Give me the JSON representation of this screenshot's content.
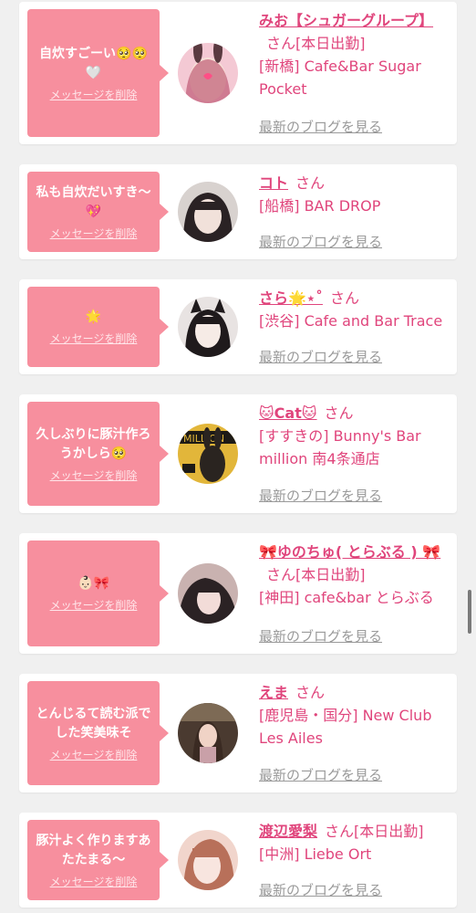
{
  "common": {
    "delete_label": "メッセージを削除",
    "blog_label": "最新のブログを見る",
    "san": "さん"
  },
  "colors": {
    "accent": "#e0457c",
    "bubble": "#f78f9e",
    "background": "#f0f0f0",
    "link_gray": "#9a9a9a"
  },
  "items": [
    {
      "message": "自炊すごーい🥺🥺🤍",
      "name": "みお【シュガーグループ】",
      "status": "[本日出勤]",
      "shop": "[新橋] Cafe&Bar Sugar Pocket"
    },
    {
      "message": "私も自炊だいすき〜💖",
      "name": "コト",
      "status": "",
      "shop": "[船橋] BAR DROP"
    },
    {
      "message": "🌟",
      "name": "さら🌟⋆˚",
      "status": "",
      "shop": "[渋谷] Cafe and Bar Trace"
    },
    {
      "message": "久しぶりに豚汁作ろうかしら🥺",
      "name": "🐱Cat🐱",
      "status": "",
      "shop": "[すすきの] Bunny's Bar million 南4条通店"
    },
    {
      "message": "👶🏻🎀",
      "name": "🎀ゆのちゅ( とらぶる ) 🎀",
      "status": "[本日出勤]",
      "shop": "[神田] cafe&bar とらぶる"
    },
    {
      "message": "とんじるて読む派でした笑美味そ",
      "name": "えま",
      "status": "",
      "shop": "[鹿児島・国分] New Club Les Ailes"
    },
    {
      "message": "豚汁よく作りますあたたまる〜",
      "name": "渡辺愛梨",
      "status": "[本日出勤]",
      "shop": "[中洲] Liebe Ort"
    }
  ]
}
